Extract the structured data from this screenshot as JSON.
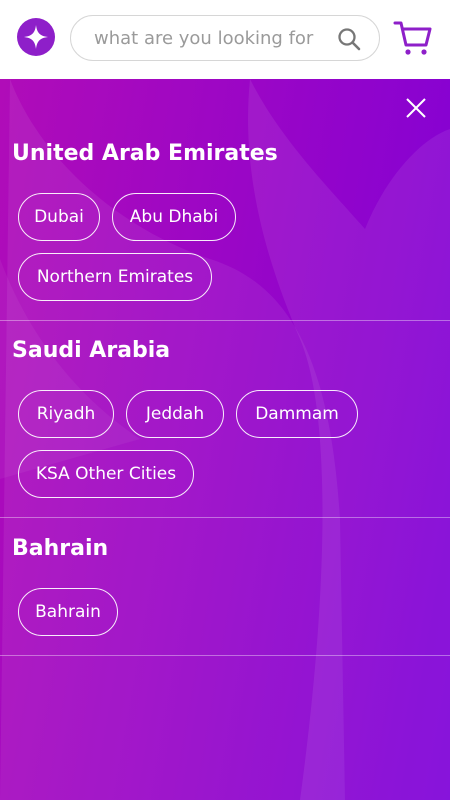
{
  "header": {
    "logo_icon": "compass-star-logo",
    "search": {
      "placeholder": "what are you looking for",
      "value": ""
    },
    "search_icon": "search-icon",
    "cart_icon": "cart-icon"
  },
  "menu": {
    "close_icon": "close-icon",
    "regions": [
      {
        "title": "United Arab Emirates",
        "cities": [
          "Dubai",
          "Abu Dhabi",
          "Northern Emirates"
        ]
      },
      {
        "title": "Saudi Arabia",
        "cities": [
          "Riyadh",
          "Jeddah",
          "Dammam",
          "KSA Other Cities"
        ]
      },
      {
        "title": "Bahrain",
        "cities": [
          "Bahrain"
        ]
      }
    ]
  },
  "colors": {
    "brand": "#8e1fc9",
    "panel_start": "#b00cb8",
    "panel_end": "#7d00d8"
  }
}
